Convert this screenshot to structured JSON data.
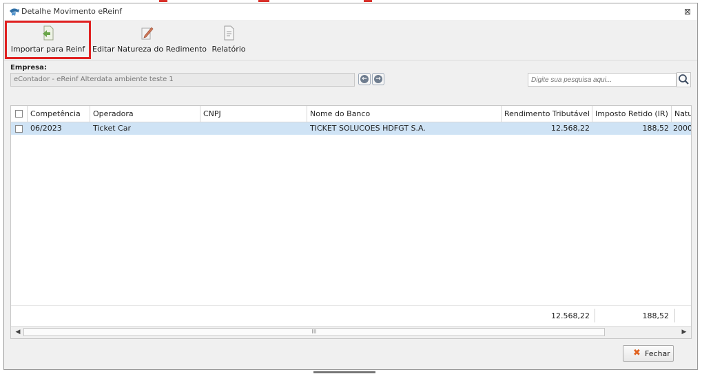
{
  "window": {
    "title": "Detalhe Movimento eReinf",
    "close_glyph": "⊠"
  },
  "toolbar": {
    "buttons": [
      {
        "label": "Importar para Reinf",
        "icon": "import-icon"
      },
      {
        "label": "Editar Natureza do Redimento",
        "icon": "edit-icon"
      },
      {
        "label": "Relatório",
        "icon": "report-icon"
      }
    ]
  },
  "empresa": {
    "label": "Empresa:",
    "value": "eContador - eReinf Alterdata ambiente teste 1"
  },
  "search": {
    "placeholder": "Digite sua pesquisa aqui..."
  },
  "grid": {
    "columns": [
      "Competência",
      "Operadora",
      "CNPJ",
      "Nome do Banco",
      "Rendimento Tributável",
      "Imposto Retido (IR)",
      "Natu"
    ],
    "rows": [
      {
        "competencia": "06/2023",
        "operadora": "Ticket Car",
        "cnpj": "",
        "banco": "TICKET SOLUCOES HDFGT S.A.",
        "rendimento": "12.568,22",
        "imposto": "188,52",
        "natureza": "2000"
      }
    ],
    "totals": {
      "rendimento": "12.568,22",
      "imposto": "188,52"
    },
    "scroll_grip": "III"
  },
  "fechar": {
    "label": "Fechar"
  },
  "colors": {
    "accent_red": "#e02020",
    "selection": "#cfe3f5",
    "close_icon": "#e0611e"
  }
}
